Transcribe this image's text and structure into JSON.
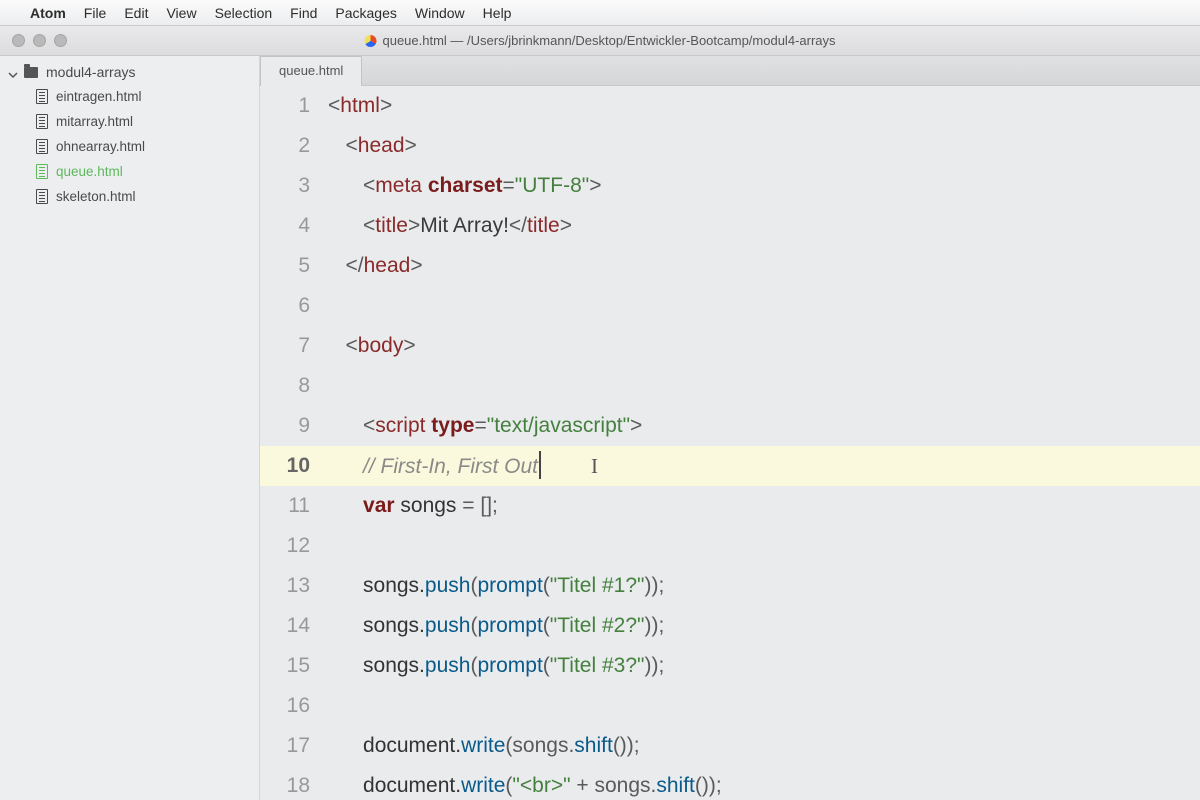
{
  "menubar": {
    "apple": "",
    "appname": "Atom",
    "items": [
      "File",
      "Edit",
      "View",
      "Selection",
      "Find",
      "Packages",
      "Window",
      "Help"
    ]
  },
  "window": {
    "title": "queue.html — /Users/jbrinkmann/Desktop/Entwickler-Bootcamp/modul4-arrays"
  },
  "sidebar": {
    "root": "modul4-arrays",
    "files": [
      {
        "name": "eintragen.html",
        "active": false
      },
      {
        "name": "mitarray.html",
        "active": false
      },
      {
        "name": "ohnearray.html",
        "active": false
      },
      {
        "name": "queue.html",
        "active": true
      },
      {
        "name": "skeleton.html",
        "active": false
      }
    ]
  },
  "tab": {
    "label": "queue.html"
  },
  "code": {
    "active_line": 10,
    "lines": [
      {
        "n": 1,
        "tokens": [
          {
            "t": "<",
            "c": "punc"
          },
          {
            "t": "html",
            "c": "tag"
          },
          {
            "t": ">",
            "c": "punc"
          }
        ],
        "indent": 0
      },
      {
        "n": 2,
        "tokens": [
          {
            "t": "<",
            "c": "punc"
          },
          {
            "t": "head",
            "c": "tag"
          },
          {
            "t": ">",
            "c": "punc"
          }
        ],
        "indent": 1
      },
      {
        "n": 3,
        "tokens": [
          {
            "t": "<",
            "c": "punc"
          },
          {
            "t": "meta ",
            "c": "tag"
          },
          {
            "t": "charset",
            "c": "attr"
          },
          {
            "t": "=",
            "c": "punc"
          },
          {
            "t": "\"UTF-8\"",
            "c": "str"
          },
          {
            "t": ">",
            "c": "punc"
          }
        ],
        "indent": 2
      },
      {
        "n": 4,
        "tokens": [
          {
            "t": "<",
            "c": "punc"
          },
          {
            "t": "title",
            "c": "tag"
          },
          {
            "t": ">",
            "c": "punc"
          },
          {
            "t": "Mit Array!",
            "c": "text"
          },
          {
            "t": "</",
            "c": "punc"
          },
          {
            "t": "title",
            "c": "tag"
          },
          {
            "t": ">",
            "c": "punc"
          }
        ],
        "indent": 2
      },
      {
        "n": 5,
        "tokens": [
          {
            "t": "</",
            "c": "punc"
          },
          {
            "t": "head",
            "c": "tag"
          },
          {
            "t": ">",
            "c": "punc"
          }
        ],
        "indent": 1
      },
      {
        "n": 6,
        "tokens": [],
        "indent": 0
      },
      {
        "n": 7,
        "tokens": [
          {
            "t": "<",
            "c": "punc"
          },
          {
            "t": "body",
            "c": "tag"
          },
          {
            "t": ">",
            "c": "punc"
          }
        ],
        "indent": 1
      },
      {
        "n": 8,
        "tokens": [],
        "indent": 0
      },
      {
        "n": 9,
        "tokens": [
          {
            "t": "<",
            "c": "punc"
          },
          {
            "t": "script ",
            "c": "tag"
          },
          {
            "t": "type",
            "c": "attr"
          },
          {
            "t": "=",
            "c": "punc"
          },
          {
            "t": "\"text/javascript\"",
            "c": "str"
          },
          {
            "t": ">",
            "c": "punc"
          }
        ],
        "indent": 2
      },
      {
        "n": 10,
        "tokens": [
          {
            "t": "// First-In, First Out",
            "c": "com"
          }
        ],
        "indent": 2,
        "cursor": true,
        "ibeam": true
      },
      {
        "n": 11,
        "tokens": [
          {
            "t": "var ",
            "c": "key"
          },
          {
            "t": "songs ",
            "c": "var"
          },
          {
            "t": "= ",
            "c": "punc"
          },
          {
            "t": "[];",
            "c": "punc"
          }
        ],
        "indent": 2
      },
      {
        "n": 12,
        "tokens": [],
        "indent": 0
      },
      {
        "n": 13,
        "tokens": [
          {
            "t": "songs.",
            "c": "var"
          },
          {
            "t": "push",
            "c": "fn"
          },
          {
            "t": "(",
            "c": "punc"
          },
          {
            "t": "prompt",
            "c": "fn"
          },
          {
            "t": "(",
            "c": "punc"
          },
          {
            "t": "\"Titel #1?\"",
            "c": "str"
          },
          {
            "t": "));",
            "c": "punc"
          }
        ],
        "indent": 2
      },
      {
        "n": 14,
        "tokens": [
          {
            "t": "songs.",
            "c": "var"
          },
          {
            "t": "push",
            "c": "fn"
          },
          {
            "t": "(",
            "c": "punc"
          },
          {
            "t": "prompt",
            "c": "fn"
          },
          {
            "t": "(",
            "c": "punc"
          },
          {
            "t": "\"Titel #2?\"",
            "c": "str"
          },
          {
            "t": "));",
            "c": "punc"
          }
        ],
        "indent": 2
      },
      {
        "n": 15,
        "tokens": [
          {
            "t": "songs.",
            "c": "var"
          },
          {
            "t": "push",
            "c": "fn"
          },
          {
            "t": "(",
            "c": "punc"
          },
          {
            "t": "prompt",
            "c": "fn"
          },
          {
            "t": "(",
            "c": "punc"
          },
          {
            "t": "\"Titel #3?\"",
            "c": "str"
          },
          {
            "t": "));",
            "c": "punc"
          }
        ],
        "indent": 2
      },
      {
        "n": 16,
        "tokens": [],
        "indent": 0
      },
      {
        "n": 17,
        "tokens": [
          {
            "t": "document.",
            "c": "var"
          },
          {
            "t": "write",
            "c": "fn"
          },
          {
            "t": "(songs.",
            "c": "punc"
          },
          {
            "t": "shift",
            "c": "fn"
          },
          {
            "t": "());",
            "c": "punc"
          }
        ],
        "indent": 2
      },
      {
        "n": 18,
        "tokens": [
          {
            "t": "document.",
            "c": "var"
          },
          {
            "t": "write",
            "c": "fn"
          },
          {
            "t": "(",
            "c": "punc"
          },
          {
            "t": "\"<br>\"",
            "c": "str"
          },
          {
            "t": " + songs.",
            "c": "punc"
          },
          {
            "t": "shift",
            "c": "fn"
          },
          {
            "t": "());",
            "c": "punc"
          }
        ],
        "indent": 2
      }
    ]
  }
}
